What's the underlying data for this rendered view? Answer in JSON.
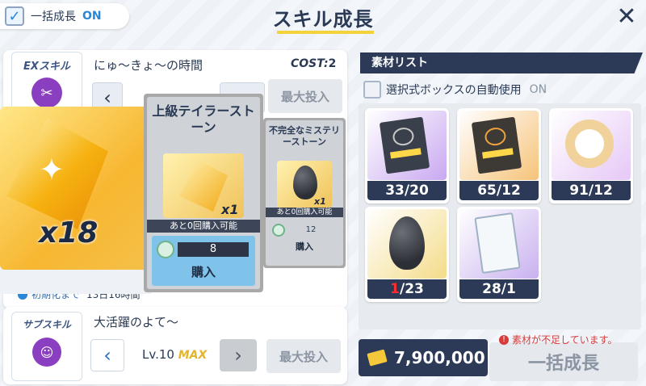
{
  "header": {
    "bulk_toggle_label": "一括成長",
    "bulk_toggle_state": "ON",
    "title": "スキル成長",
    "close_glyph": "✕"
  },
  "ex_skill": {
    "tab_label": "EXスキル",
    "name": "にゅ〜きょ〜の時間",
    "cost_label": "COST:",
    "cost_value": "2",
    "max_label": "最大投入",
    "reset_label": "初期化まで",
    "reset_time": "13日16時間"
  },
  "popup": {
    "big_item_count": "x18",
    "card1": {
      "title": "上級テイラーストーン",
      "qty": "x1",
      "availability": "あと0回購入可能",
      "price": "8",
      "buy_label": "購入"
    },
    "card2": {
      "title": "不完全なミステリーストーン",
      "qty": "x1",
      "availability": "あと0回購入可能",
      "price": "12",
      "buy_label": "購入"
    }
  },
  "sub_skill": {
    "tab_label": "サブスキル",
    "name": "大活躍のよて〜",
    "level": "Lv.10",
    "level_max": "MAX",
    "max_label": "最大投入"
  },
  "materials": {
    "header": "素材リスト",
    "auto_use_label": "選択式ボックスの自動使用",
    "auto_use_state": "ON",
    "items": [
      {
        "name": "purple-tech-note-icon",
        "have": "33",
        "need": "20",
        "bg": "#c9a8f0"
      },
      {
        "name": "orange-tech-note-icon",
        "have": "65",
        "need": "12",
        "bg": "#f6c37a"
      },
      {
        "name": "gold-ring-artifact-icon",
        "have": "91",
        "need": "12",
        "bg": "#e6c8f6"
      },
      {
        "name": "mystery-stone-icon",
        "have": "1",
        "need": "23",
        "bg": "#f4dc8a"
      },
      {
        "name": "notebook-icon",
        "have": "28",
        "need": "1",
        "bg": "#c9b1ef"
      }
    ]
  },
  "footer": {
    "credits": "7,900,000",
    "warning": "素材が不足しています。",
    "bulk_button": "一括成長"
  },
  "colors": {
    "accent": "#2b86d6",
    "navy": "#2c3a57",
    "warning": "#d83b3b",
    "underline": "#f4d23a"
  }
}
